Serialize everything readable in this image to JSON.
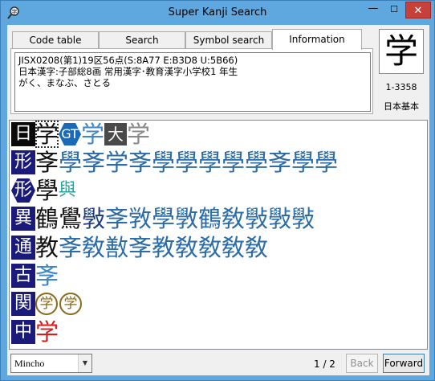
{
  "window": {
    "title": "Super Kanji Search",
    "min_glyph": "—",
    "max_glyph": "☐",
    "close_glyph": "✕",
    "icon": "magnifier-icon"
  },
  "tabs": [
    {
      "label": "Code table",
      "active": false
    },
    {
      "label": "Search",
      "active": false
    },
    {
      "label": "Symbol search",
      "active": false
    },
    {
      "label": "Information",
      "active": true
    }
  ],
  "info": {
    "text": "JISX0208(第1)19区56点(S:8A77 E:B3D8 U:5B66)\n日本漢字:子部総8画 常用漢字･教育漢字小学校1 年生\nがく、まなぶ、さとる"
  },
  "preview": {
    "glyph": "学",
    "code": "1-3358",
    "set": "日本基本"
  },
  "rows": [
    {
      "tag": "日",
      "tag_style": "black",
      "items": [
        {
          "t": "学",
          "c": "black",
          "dotted": true
        },
        {
          "badge": "GT"
        },
        {
          "t": "学",
          "c": "lightblue"
        },
        {
          "badge": "大"
        },
        {
          "t": "学",
          "c": "gray"
        }
      ]
    },
    {
      "tag": "形",
      "tag_style": "",
      "items": [
        {
          "t": "斈",
          "c": "black"
        },
        {
          "t": "學斈学斈學學學學學斈學學",
          "c": "blue"
        }
      ]
    },
    {
      "tag": "形",
      "tag_style": "hex",
      "items": [
        {
          "t": "學",
          "c": "black"
        },
        {
          "t": "與",
          "c": "teal"
        }
      ]
    },
    {
      "tag": "異",
      "tag_style": "",
      "items": [
        {
          "t": "鶴鷽",
          "c": "black"
        },
        {
          "t": "斅",
          "c": "dark"
        },
        {
          "t": "斈敩學斆鶴敎斅斅斅",
          "c": "blue"
        }
      ]
    },
    {
      "tag": "通",
      "tag_style": "",
      "items": [
        {
          "t": "教",
          "c": "black"
        },
        {
          "t": "斈敎敾斈教敎敎敎敎",
          "c": "blue"
        }
      ]
    },
    {
      "tag": "古",
      "tag_style": "",
      "items": [
        {
          "t": "斈",
          "c": "lightblue"
        }
      ]
    },
    {
      "tag": "関",
      "tag_style": "",
      "items": [
        {
          "circle": "学"
        },
        {
          "circle": "学"
        }
      ]
    },
    {
      "tag": "中",
      "tag_style": "",
      "items": [
        {
          "t": "学",
          "c": "red"
        }
      ]
    }
  ],
  "bottom": {
    "font": "Mincho",
    "page": "1 / 2",
    "back": "Back",
    "forward": "Forward"
  }
}
